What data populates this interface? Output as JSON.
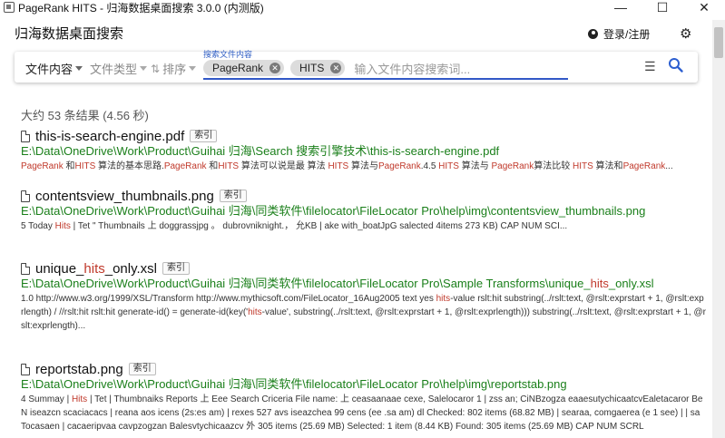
{
  "window": {
    "title": "PageRank HITS - 归海数据桌面搜索 3.0.0 (内测版)",
    "buttons": [
      "—",
      "☐",
      "✕"
    ]
  },
  "header": {
    "app_name": "归海数据桌面搜索",
    "login_label": "登录/注册",
    "login_icon": "user-circle-icon",
    "settings_icon": "gear-icon"
  },
  "searchbar": {
    "filter_content": "文件内容",
    "filter_type": "文件类型",
    "sort": "排序",
    "query_label": "搜索文件内容",
    "chips": [
      {
        "label": "PageRank"
      },
      {
        "label": "HITS"
      }
    ],
    "placeholder": "输入文件内容搜索词...",
    "list_icon": "list-icon",
    "search_icon": "search-icon"
  },
  "summary": "大约 53 条结果 (4.56 秒)",
  "results": [
    {
      "title_pre": "this-is-search-engine.pdf",
      "title_hl": "",
      "title_post": "",
      "badge": "索引",
      "path": "E:\\Data\\OneDrive\\Work\\Product\\Guihai 归海\\Search 搜索引擎技术\\this-is-search-engine.pdf",
      "snippet_html": "<span class=\"hl\">PageRank</span> 和<span class=\"hl\">HITS</span> 算法的基本思路.<span class=\"hl\">PageRank</span> 和<span class=\"hl\">HITS</span> 算法可以说是最 算法 <span class=\"hl\">HITS</span> 算法与<span class=\"hl\">PageRank</span>.4.5 <span class=\"hl\">HITS</span> 算法与 <span class=\"hl\">PageRank</span>算法比较 <span class=\"hl\">HITS</span> 算法和<span class=\"hl\">PageRank</span>..."
    },
    {
      "title_pre": "contentsview_thumbnails.png",
      "title_hl": "",
      "title_post": "",
      "badge": "索引",
      "path": "E:\\Data\\OneDrive\\Work\\Product\\Guihai 归海\\同类软件\\filelocator\\FileLocator Pro\\help\\img\\contentsview_thumbnails.png",
      "snippet_html": "5 Today <span class=\"hl\">Hits</span> | Tet \" Thumbnails 上 doggrassjpg 。 dubrovniknight.， 允KB | ake with_boatJpG salected 4items 273 KB) CAP NUM SCI..."
    },
    {
      "title_pre": "unique_",
      "title_hl": "hits",
      "title_post": "_only.xsl",
      "badge": "索引",
      "path_html": "E:\\Data\\OneDrive\\Work\\Product\\Guihai 归海\\同类软件\\filelocator\\FileLocator Pro\\Sample Transforms\\unique_<span class=\"hl\">hits</span>_only.xsl",
      "snippet_html": "1.0 http://www.w3.org/1999/XSL/Transform http://www.mythicsoft.com/FileLocator_16Aug2005 text yes <span class=\"hl\">hits</span>-value rslt:hit substring(../rslt:text, @rslt:exprstart + 1, @rslt:exprlength) / //rslt:hit rslt:hit generate-id() = generate-id(key('<span class=\"hl\">hits</span>-value', substring(../rslt:text, @rslt:exprstart + 1, @rslt:exprlength))) substring(../rslt:text, @rslt:exprstart + 1, @rslt:exprlength)..."
    },
    {
      "title_pre": "reportstab.png",
      "title_hl": "",
      "title_post": "",
      "badge": "索引",
      "path": "E:\\Data\\OneDrive\\Work\\Product\\Guihai 归海\\同类软件\\filelocator\\FileLocator Pro\\help\\img\\reportstab.png",
      "snippet_html": "4 Summay | <span class=\"hl\">Hits</span> | Tet | Thumbnaiks Reports 上 Eee Search Criceria File name: 上 ceasaanaae cexe, Salelocaror 1 | zss an; CiNBzogza eaaesutychicaatcvEaletacaror BeN iseazcn scaciacacs | reana aos icens (2s:es am) | rexes 527 avs iseazchea 99 cens (ee .sa am) dl Checked: 802 items (68.82 MB) | searaa, comgaerea (e 1 see) | | sa Tocasaen | cacaeripvaa cavpzogzan Balesvtychicaazcv 外 305 items (25.69 MB) Selected: 1 item (8.44 KB) Found: 305 items (25.69 MB) CAP NUM SCRL"
    }
  ]
}
